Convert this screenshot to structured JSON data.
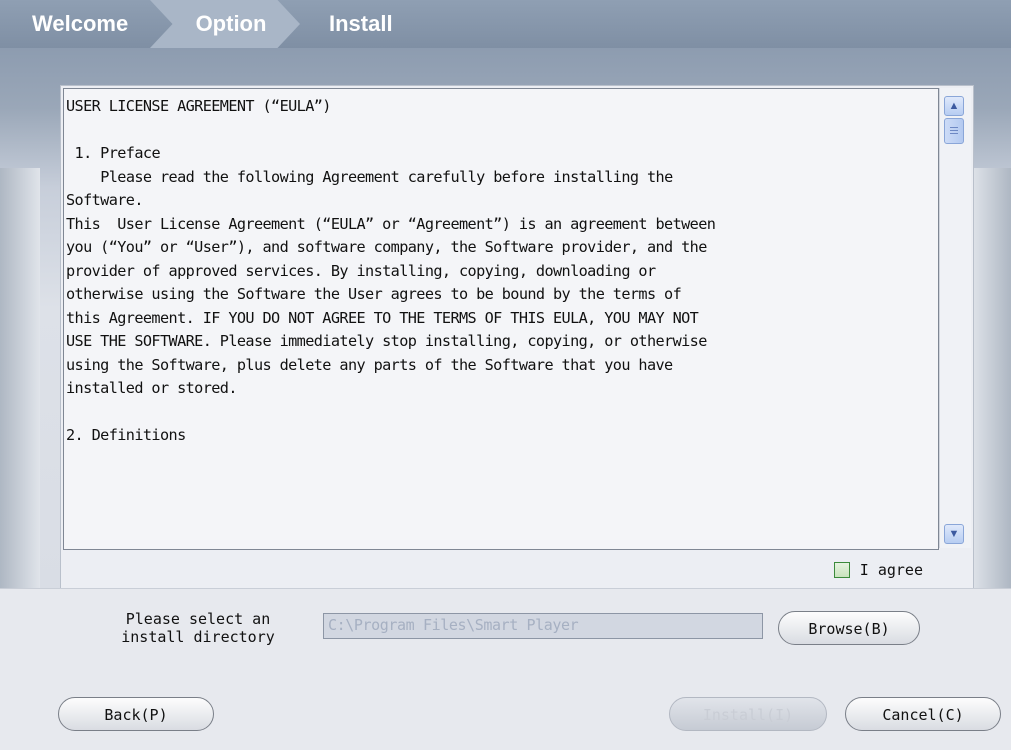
{
  "wizard": {
    "steps": [
      "Welcome",
      "Option",
      "Install"
    ],
    "active_step": "Option"
  },
  "eula": {
    "text": "USER LICENSE AGREEMENT (“EULA”)\n\n 1. Preface\n    Please read the following Agreement carefully before installing the\nSoftware.\nThis  User License Agreement (“EULA” or “Agreement”) is an agreement between\nyou (“You” or “User”), and software company, the Software provider, and the\nprovider of approved services. By installing, copying, downloading or\notherwise using the Software the User agrees to be bound by the terms of\nthis Agreement. IF YOU DO NOT AGREE TO THE TERMS OF THIS EULA, YOU MAY NOT\nUSE THE SOFTWARE. Please immediately stop installing, copying, or otherwise\nusing the Software, plus delete any parts of the Software that you have\ninstalled or stored.\n\n2. Definitions",
    "agree_label": "I agree",
    "agree_checked": false
  },
  "install_dir": {
    "label": "Please select an\ninstall directory",
    "value": "C:\\Program Files\\Smart Player"
  },
  "buttons": {
    "browse": "Browse(B)",
    "back": "Back(P)",
    "install": "Install(I)",
    "cancel": "Cancel(C)"
  },
  "icons": {
    "scroll_up": "chevron-up-icon",
    "scroll_down": "chevron-down-icon"
  }
}
